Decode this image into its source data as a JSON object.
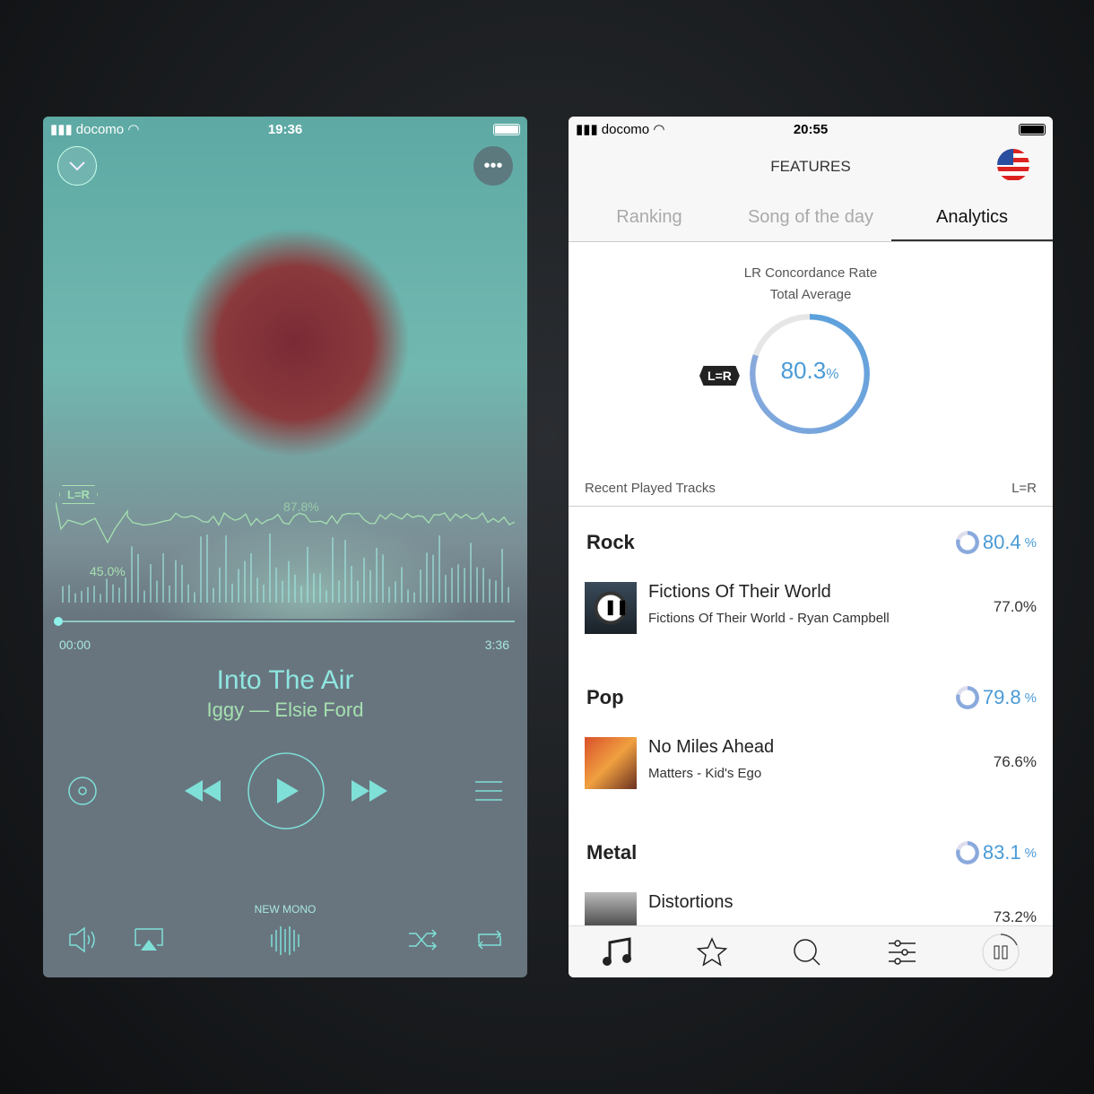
{
  "player": {
    "status": {
      "carrier": "docomo",
      "time": "19:36"
    },
    "badge": "L=R",
    "peak": "87.8%",
    "low": "45.0%",
    "progress": {
      "elapsed": "00:00",
      "duration": "3:36",
      "fraction": 0
    },
    "song": "Into The Air",
    "album": "Iggy",
    "separator": "—",
    "artist": "Elsie Ford",
    "mode": "NEW MONO",
    "colors": {
      "accent": "#7fe0d8",
      "line": "#a6e0b0"
    }
  },
  "features": {
    "status": {
      "carrier": "docomo",
      "time": "20:55"
    },
    "title": "FEATURES",
    "tabs": [
      {
        "label": "Ranking"
      },
      {
        "label": "Song of the day"
      },
      {
        "label": "Analytics",
        "active": true
      }
    ],
    "summary": {
      "label1": "LR Concordance Rate",
      "label2": "Total Average",
      "badge": "L=R",
      "value": "80.3",
      "unit": "%",
      "fraction": 0.803
    },
    "list_header": {
      "left": "Recent Played Tracks",
      "right": "L=R"
    },
    "genres": [
      {
        "name": "Rock",
        "value": "80.4",
        "unit": "%",
        "track": {
          "title": "Fictions Of Their World",
          "sub": "Fictions Of Their World - Ryan Campbell",
          "pct": "77.0%"
        }
      },
      {
        "name": "Pop",
        "value": "79.8",
        "unit": "%",
        "track": {
          "title": "No Miles Ahead",
          "sub": "Matters - Kid's Ego",
          "pct": "76.6%"
        }
      },
      {
        "name": "Metal",
        "value": "83.1",
        "unit": "%",
        "track": {
          "title": "Distortions",
          "sub": "",
          "pct": "73.2%"
        }
      }
    ],
    "nav": [
      "music-icon",
      "star-icon",
      "search-icon",
      "equalizer-icon",
      "pause-icon"
    ],
    "colors": {
      "accent": "#4a9ad6"
    }
  }
}
